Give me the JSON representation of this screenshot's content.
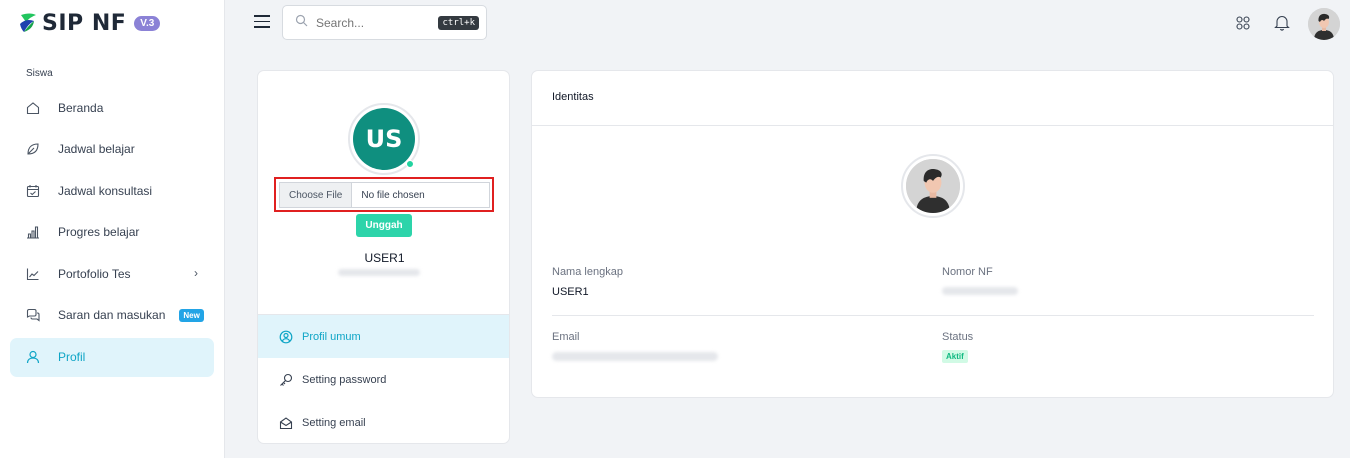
{
  "app": {
    "name": "SIP NF",
    "version": "V.3"
  },
  "sidebar": {
    "section": "Siswa",
    "items": [
      {
        "label": "Beranda",
        "icon": "home-icon"
      },
      {
        "label": "Jadwal belajar",
        "icon": "leaf-icon"
      },
      {
        "label": "Jadwal konsultasi",
        "icon": "calendar-check-icon"
      },
      {
        "label": "Progres belajar",
        "icon": "bar-chart-icon"
      },
      {
        "label": "Portofolio Tes",
        "icon": "line-chart-icon",
        "has_submenu": true
      },
      {
        "label": "Saran dan masukan",
        "icon": "chat-icon",
        "badge": "New"
      },
      {
        "label": "Profil",
        "icon": "user-icon",
        "active": true
      }
    ]
  },
  "topbar": {
    "search_placeholder": "Search...",
    "search_shortcut": "ctrl+k"
  },
  "profile": {
    "initials": "US",
    "file_button": "Choose File",
    "file_status": "No file chosen",
    "upload_label": "Unggah",
    "username": "USER1",
    "menu": [
      {
        "label": "Profil umum",
        "icon": "user-circle-icon",
        "active": true
      },
      {
        "label": "Setting password",
        "icon": "key-icon"
      },
      {
        "label": "Setting email",
        "icon": "envelope-open-icon"
      }
    ]
  },
  "identity": {
    "title": "Identitas",
    "full_name_label": "Nama lengkap",
    "full_name": "USER1",
    "nf_number_label": "Nomor NF",
    "email_label": "Email",
    "status_label": "Status",
    "status": "Aktif"
  },
  "colors": {
    "accent": "#0ea5c6",
    "active_bg": "#e0f4fb",
    "avatar_bg": "#0f8f7f",
    "upload_button": "#2dd4aa",
    "highlight_border": "#e02020",
    "version_badge": "#8b82d6"
  }
}
